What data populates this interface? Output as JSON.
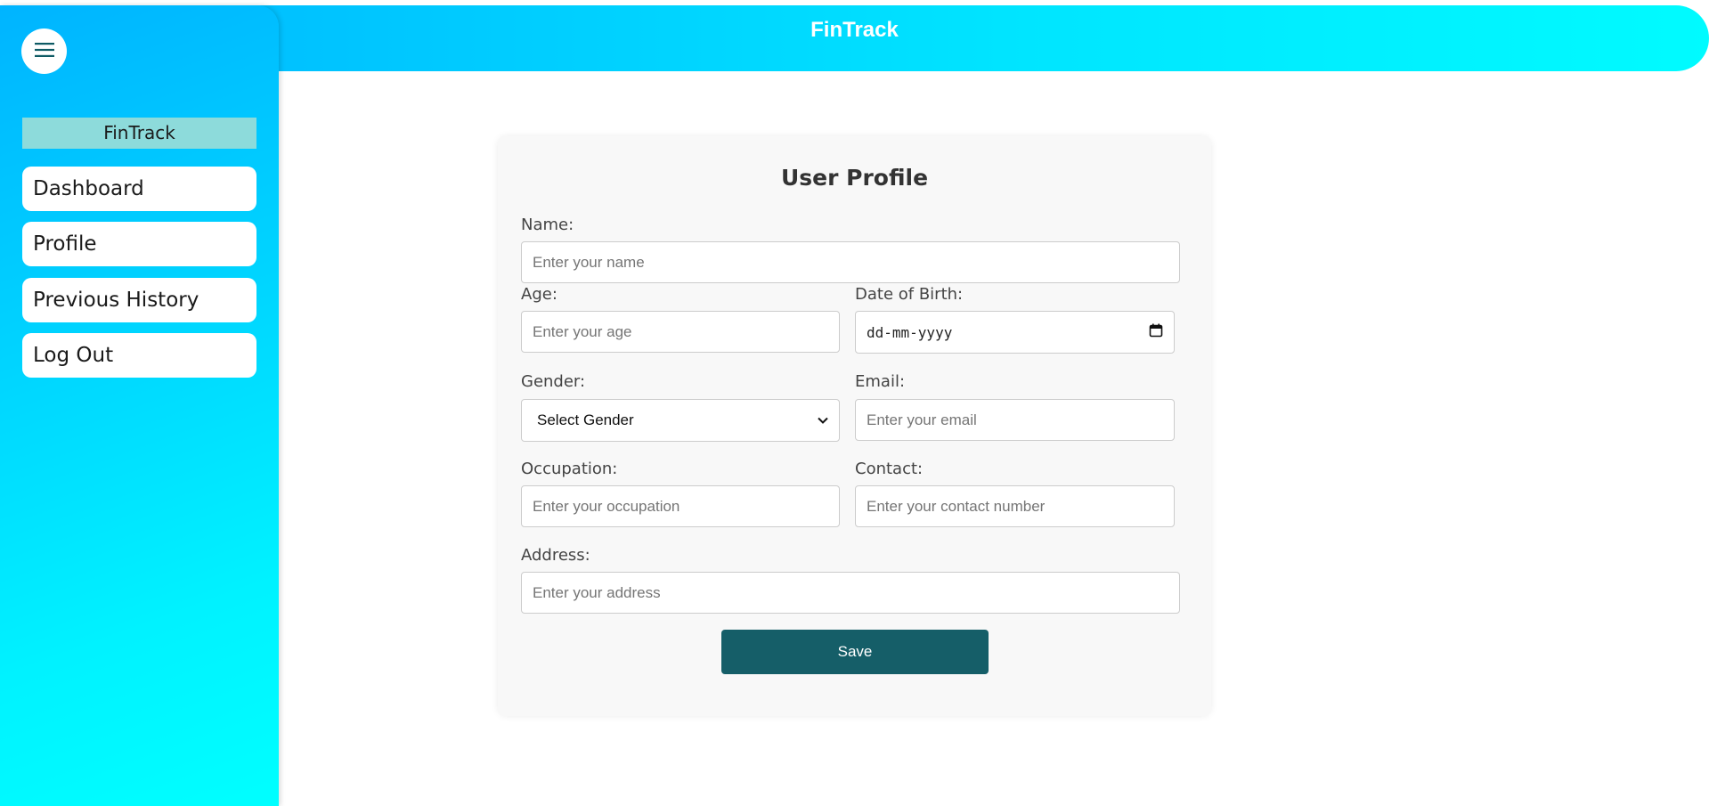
{
  "header": {
    "title": "FinTrack"
  },
  "sidebar": {
    "menu_icon": "hamburger-menu-icon",
    "brand": "FinTrack",
    "items": [
      {
        "label": "Dashboard"
      },
      {
        "label": "Profile"
      },
      {
        "label": "Previous History"
      },
      {
        "label": "Log Out"
      }
    ]
  },
  "form": {
    "title": "User Profile",
    "name": {
      "label": "Name:",
      "placeholder": "Enter your name"
    },
    "age": {
      "label": "Age:",
      "placeholder": "Enter your age"
    },
    "dob": {
      "label": "Date of Birth:",
      "value": "dd-mm-yyyy",
      "icon": "calendar-icon"
    },
    "gender": {
      "label": "Gender:",
      "selected": "Select Gender",
      "icon": "chevron-down-icon"
    },
    "email": {
      "label": "Email:",
      "placeholder": "Enter your email"
    },
    "occupation": {
      "label": "Occupation:",
      "placeholder": "Enter your occupation"
    },
    "contact": {
      "label": "Contact:",
      "placeholder": "Enter your contact number"
    },
    "address": {
      "label": "Address:",
      "placeholder": "Enter your address"
    },
    "save_label": "Save"
  },
  "colors": {
    "gradient_start": "#00b4ff",
    "gradient_end": "#00ffff",
    "brand_bg": "#8ddbdb",
    "save_button": "#155e68",
    "card_bg": "#f8f8f8"
  }
}
